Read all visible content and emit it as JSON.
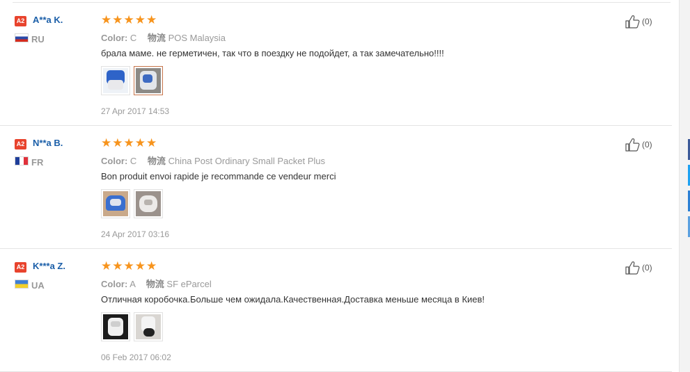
{
  "reviews": [
    {
      "badge": "A2",
      "name": "A**a K.",
      "country": "RU",
      "color_label": "Color:",
      "color_value": "C",
      "shipping_label": "物流",
      "shipping_value": "POS Malaysia",
      "text": "брала маме. не герметичен, так что в поездку не подойдет, а так замечательно!!!!",
      "date": "27 Apr 2017 14:53",
      "helpful_count": "(0)",
      "rating": 5
    },
    {
      "badge": "A2",
      "name": "N**a B.",
      "country": "FR",
      "color_label": "Color:",
      "color_value": "C",
      "shipping_label": "物流",
      "shipping_value": "China Post Ordinary Small Packet Plus",
      "text": "Bon produit envoi rapide je recommande ce vendeur merci",
      "date": "24 Apr 2017 03:16",
      "helpful_count": "(0)",
      "rating": 5
    },
    {
      "badge": "A2",
      "name": "K***a Z.",
      "country": "UA",
      "color_label": "Color:",
      "color_value": "A",
      "shipping_label": "物流",
      "shipping_value": "SF eParcel",
      "text": "Отличная коробочка.Больше чем ожидала.Качественная.Доставка меньше месяца в Киев!",
      "date": "06 Feb 2017 06:02",
      "helpful_count": "(0)",
      "rating": 5
    }
  ],
  "colors": {
    "accent_star": "#f7941d",
    "name_link": "#1a5ea8",
    "badge": "#e8432d",
    "muted": "#999999"
  }
}
